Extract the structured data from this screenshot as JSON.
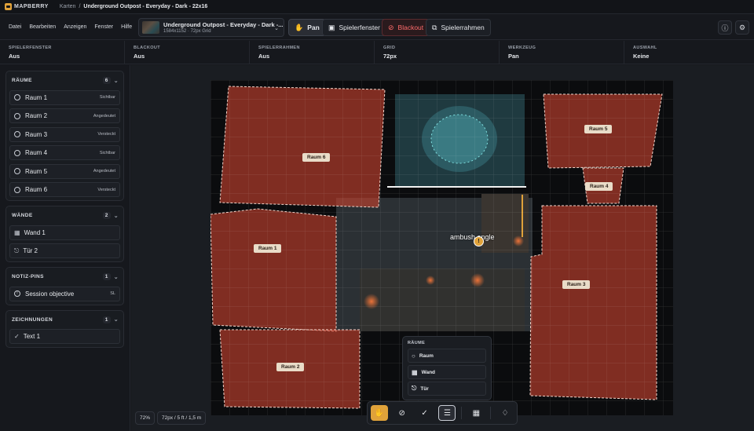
{
  "app": {
    "logo": "MAPBERRY"
  },
  "breadcrumb": {
    "parent": "Karten",
    "separator": "/",
    "current": "Underground Outpost - Everyday - Dark - 22x16"
  },
  "menu": [
    "Datei",
    "Bearbeiten",
    "Anzeigen",
    "Fenster",
    "Hilfe"
  ],
  "map_select": {
    "title": "Underground Outpost - Everyday - Dark -...",
    "subtitle": "1584x1152 · 72px Grid"
  },
  "toolbar": {
    "pan": "Pan",
    "player_window": "Spielerfenster",
    "blackout": "Blackout",
    "player_frame": "Spielerrahmen"
  },
  "status": [
    {
      "label": "SPIELERFENSTER",
      "value": "Aus"
    },
    {
      "label": "BLACKOUT",
      "value": "Aus"
    },
    {
      "label": "SPIELERRAHMEN",
      "value": "Aus"
    },
    {
      "label": "GRID",
      "value": "72px"
    },
    {
      "label": "WERKZEUG",
      "value": "Pan"
    },
    {
      "label": "AUSWAHL",
      "value": "Keine"
    }
  ],
  "sidebar": {
    "rooms": {
      "title": "RÄUME",
      "count": "6",
      "items": [
        {
          "label": "Raum 1",
          "state": "Sichtbar"
        },
        {
          "label": "Raum 2",
          "state": "Angedeutet"
        },
        {
          "label": "Raum 3",
          "state": "Versteckt"
        },
        {
          "label": "Raum 4",
          "state": "Sichtbar"
        },
        {
          "label": "Raum 5",
          "state": "Angedeutet"
        },
        {
          "label": "Raum 6",
          "state": "Versteckt"
        }
      ]
    },
    "walls": {
      "title": "WÄNDE",
      "count": "2",
      "items": [
        {
          "label": "Wand 1"
        },
        {
          "label": "Tür 2"
        }
      ]
    },
    "pins": {
      "title": "NOTIZ-PINS",
      "count": "1",
      "items": [
        {
          "label": "Session objective",
          "tag": "SL"
        }
      ]
    },
    "drawings": {
      "title": "ZEICHNUNGEN",
      "count": "1",
      "items": [
        {
          "label": "Text 1"
        }
      ]
    }
  },
  "map": {
    "room_labels": [
      "Raum 6",
      "Raum 5",
      "Raum 4",
      "Raum 1",
      "Raum 3",
      "Raum 2"
    ],
    "pin": {
      "label": "ambush angle",
      "glyph": "!"
    }
  },
  "popup": {
    "title": "RÄUME",
    "items": [
      "Raum",
      "Wand",
      "Tür"
    ]
  },
  "zoom": {
    "level": "72%",
    "scale": "72px / 5 ft / 1,5 m"
  },
  "colors": {
    "accent": "#e0a23a",
    "danger": "#ff6b6b",
    "room_fill": "#c8422e"
  }
}
